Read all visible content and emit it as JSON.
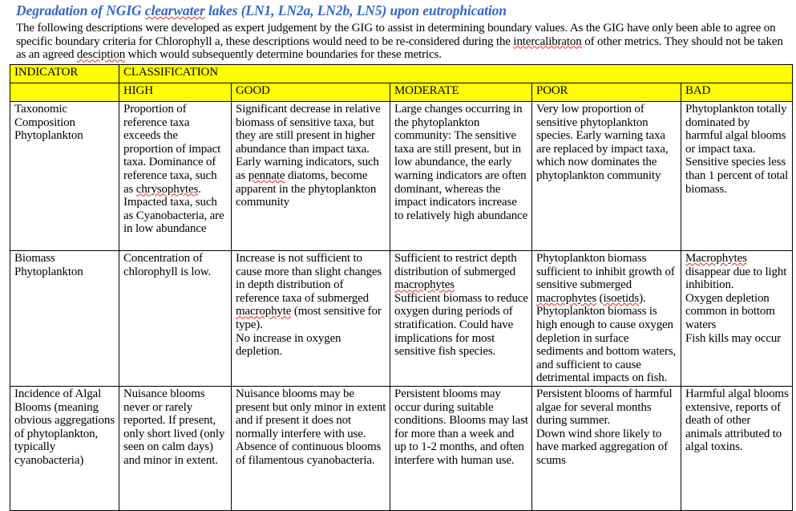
{
  "document": {
    "title_parts": [
      {
        "text": "Degradation of NGIG ",
        "misspelled": false
      },
      {
        "text": "clearwater",
        "misspelled": true
      },
      {
        "text": " lakes (LN1, LN2a, LN2b, LN5) upon eutrophication",
        "misspelled": false
      }
    ],
    "title_plain": "Degradation of NGIG clearwater lakes (LN1, LN2a, LN2b, LN5) upon eutrophication",
    "title_color": "#3366cc",
    "intro_parts": [
      {
        "text": "The following descriptions were developed as expert judgement by the GIG to assist in determining boundary values.  As the GIG have only been able to agree on specific boundary criteria for Chlorophyll a, these descriptions would need to be re-considered during the ",
        "misspelled": false
      },
      {
        "text": "intercalibraton",
        "misspelled": true
      },
      {
        "text": " of other metrics.  They should not be taken as an agreed ",
        "misspelled": false
      },
      {
        "text": "desciption",
        "misspelled": true
      },
      {
        "text": " which would subsequently determine boundaries for these metrics.",
        "misspelled": false
      }
    ],
    "intro_plain": "The following descriptions were developed as expert judgement by the GIG to assist in determining boundary values.  As the GIG have only been able to agree on specific boundary criteria for Chlorophyll a, these descriptions would need to be re-considered during the intercalibraton of other metrics.  They should not be taken as an agreed desciption which would subsequently determine boundaries for these metrics.",
    "spellcheck_color": "#ee2222"
  },
  "table": {
    "header_background": "#ffff00",
    "group_headers": {
      "indicator": "INDICATOR",
      "classification": "CLASSIFICATION"
    },
    "class_headers": {
      "blank": "",
      "high": "HIGH",
      "good": "GOOD",
      "moderate": "MODERATE",
      "poor": "POOR",
      "bad": "BAD"
    },
    "rows": [
      {
        "indicator": "Taxonomic Composition Phytoplankton",
        "high_parts": [
          {
            "text": "Proportion of reference taxa exceeds the proportion of impact taxa. Dominance of reference taxa, such as ",
            "misspelled": false
          },
          {
            "text": "chrysophytes",
            "misspelled": true
          },
          {
            "text": ". Impacted taxa, such as  Cyanobacteria, are in low abundance",
            "misspelled": false
          }
        ],
        "high": "Proportion of reference taxa exceeds the proportion of impact taxa. Dominance of reference taxa, such as chrysophytes. Impacted taxa, such as  Cyanobacteria, are in low abundance",
        "good_parts": [
          {
            "text": "Significant decrease in relative biomass of sensitive taxa, but they are still present in higher abundance than impact taxa. Early warning indicators, such as ",
            "misspelled": false
          },
          {
            "text": "pennate",
            "misspelled": true
          },
          {
            "text": " diatoms, become apparent in the phytoplankton community",
            "misspelled": false
          }
        ],
        "good": "Significant decrease in relative biomass of sensitive taxa, but they are still present in higher abundance than impact taxa. Early warning indicators, such as pennate diatoms, become apparent in the phytoplankton community",
        "moderate_parts": [
          {
            "text": "Large changes occurring in the phytoplankton community: The sensitive taxa are still present, but in low abundance, the early warning indicators are often dominant, whereas the impact indicators increase to relatively high abundance",
            "misspelled": false
          }
        ],
        "moderate": "Large changes occurring in the phytoplankton community: The sensitive taxa are still present, but in low abundance, the early warning indicators are often dominant, whereas the impact indicators increase to relatively high abundance",
        "poor_parts": [
          {
            "text": "Very low proportion of sensitive phytoplankton species. Early warning taxa are replaced by impact taxa, which now dominates the phytoplankton community",
            "misspelled": false
          }
        ],
        "poor": "Very low proportion of sensitive phytoplankton species. Early warning taxa are replaced by impact taxa, which now dominates the phytoplankton community",
        "bad_parts": [
          {
            "text": "Phytoplankton totally dominated by harmful algal blooms or impact taxa.\nSensitive species less than 1 percent of total biomass.",
            "misspelled": false
          }
        ],
        "bad": "Phytoplankton totally dominated by harmful algal blooms or impact taxa.\nSensitive species less than 1 percent of total biomass."
      },
      {
        "indicator": "Biomass Phytoplankton",
        "high_parts": [
          {
            "text": "Concentration of chlorophyll is low.",
            "misspelled": false
          }
        ],
        "high": "Concentration of chlorophyll is low.",
        "good_parts": [
          {
            "text": "Increase is not sufficient to cause more than slight changes in depth distribution of reference taxa of submerged ",
            "misspelled": false
          },
          {
            "text": "macrophyte",
            "misspelled": true
          },
          {
            "text": " (most sensitive for type).\nNo increase in oxygen depletion.",
            "misspelled": false
          }
        ],
        "good": "Increase is not sufficient to cause more than slight changes in depth distribution of reference taxa of submerged macrophyte (most sensitive for type).\nNo increase in oxygen depletion.",
        "moderate_parts": [
          {
            "text": "Sufficient to restrict depth distribution of submerged ",
            "misspelled": false
          },
          {
            "text": "macrophytes",
            "misspelled": true
          },
          {
            "text": "\nSufficient biomass to reduce oxygen during periods of stratification. Could have implications for most sensitive fish species.",
            "misspelled": false
          }
        ],
        "moderate": "Sufficient to restrict depth distribution of submerged macrophytes\nSufficient biomass to reduce oxygen during periods of stratification. Could have implications for most sensitive fish species.",
        "poor_parts": [
          {
            "text": "Phytoplankton biomass sufficient to inhibit growth of sensitive submerged ",
            "misspelled": false
          },
          {
            "text": "macrophytes",
            "misspelled": true
          },
          {
            "text": " (",
            "misspelled": false
          },
          {
            "text": "isoetids",
            "misspelled": true
          },
          {
            "text": "). Phytoplankton biomass is high enough to cause oxygen depletion in surface sediments and bottom waters, and sufficient to cause detrimental impacts on fish.",
            "misspelled": false
          }
        ],
        "poor": "Phytoplankton biomass sufficient to inhibit growth of sensitive submerged macrophytes (isoetids). Phytoplankton biomass is high enough to cause oxygen depletion in surface sediments and bottom waters, and sufficient to cause detrimental impacts on fish.",
        "bad_parts": [
          {
            "text": "Macrophytes",
            "misspelled": true
          },
          {
            "text": " disappear due to light inhibition.\nOxygen depletion common in bottom waters\nFish kills may occur",
            "misspelled": false
          }
        ],
        "bad": "Macrophytes disappear due to light inhibition.\nOxygen depletion common in bottom waters\nFish kills may occur"
      },
      {
        "indicator": "Incidence of Algal Blooms (meaning obvious aggregations of phytoplankton, typically cyanobacteria)",
        "high_parts": [
          {
            "text": "Nuisance blooms never or rarely reported. If present, only short lived (only seen on calm days) and minor in extent.",
            "misspelled": false
          }
        ],
        "high": "Nuisance blooms never or rarely reported. If present, only short lived (only seen on calm days) and minor in extent.",
        "good_parts": [
          {
            "text": "Nuisance blooms may be present but only minor in extent and if present it does not normally interfere with use.\nAbsence of continuous blooms of filamentous cyanobacteria.",
            "misspelled": false
          }
        ],
        "good": "Nuisance blooms may be present but only minor in extent and if present it does not normally interfere with use.\nAbsence of continuous blooms of filamentous cyanobacteria.",
        "moderate_parts": [
          {
            "text": "Persistent blooms may occur during suitable conditions. Blooms may last for more than a week and up to 1-2 months, and often interfere with human use.",
            "misspelled": false
          }
        ],
        "moderate": "Persistent blooms may occur during suitable conditions. Blooms may last for more than a week and up to 1-2 months, and often interfere with human use.",
        "poor_parts": [
          {
            "text": "Persistent blooms of harmful algae for several months during summer.\nDown wind shore likely to have marked aggregation of scums",
            "misspelled": false
          }
        ],
        "poor": "Persistent blooms of harmful algae for several months during summer.\nDown wind shore likely to have marked aggregation of scums",
        "bad_parts": [
          {
            "text": "Harmful algal blooms extensive, reports of death of other animals attributed to algal toxins.",
            "misspelled": false
          }
        ],
        "bad": "Harmful algal blooms extensive, reports of death of other animals attributed to algal toxins."
      }
    ]
  }
}
